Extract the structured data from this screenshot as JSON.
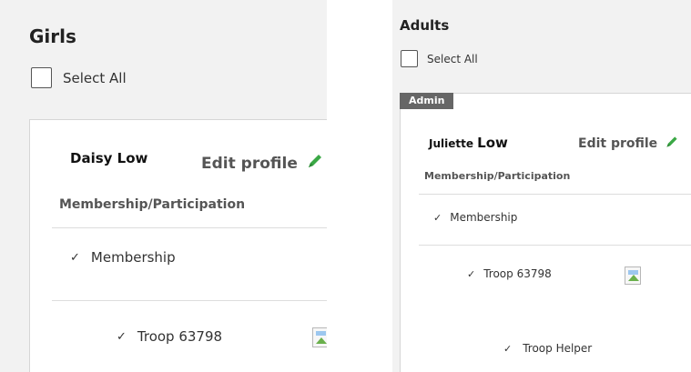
{
  "girls": {
    "heading": "Girls",
    "select_all": "Select All",
    "card": {
      "first_name": "Daisy",
      "last_name": "Low",
      "edit_label": "Edit profile",
      "section_label": "Membership/Participation",
      "membership_label": "Membership",
      "troop_label": "Troop 63798"
    }
  },
  "adults": {
    "heading": "Adults",
    "select_all": "Select All",
    "badge": "Admin",
    "card": {
      "first_name": "Juliette",
      "last_name": "Low",
      "edit_label": "Edit profile",
      "section_label": "Membership/Participation",
      "membership_label": "Membership",
      "troop_label": "Troop 63798",
      "role_label": "Troop Helper"
    }
  },
  "colors": {
    "pencil": "#3aa845",
    "badge_bg": "#666666"
  },
  "icons": {
    "edit": "pencil-icon",
    "check": "checkmark-icon",
    "image": "broken-image-icon"
  }
}
